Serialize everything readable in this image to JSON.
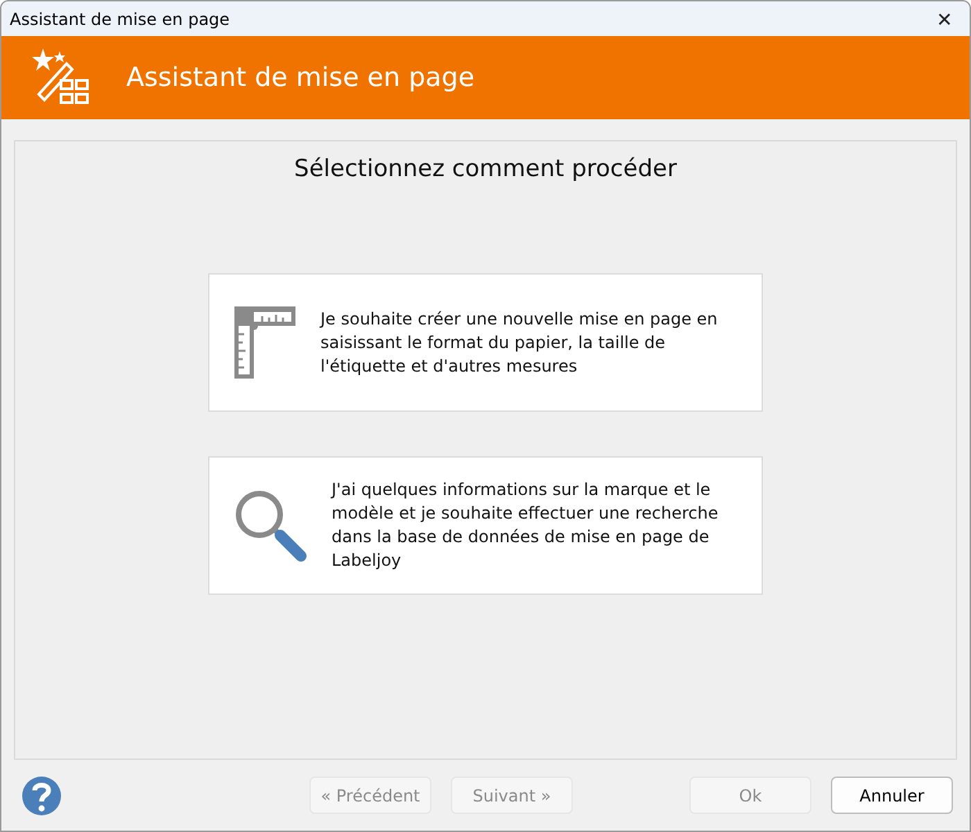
{
  "window": {
    "title": "Assistant de mise en page",
    "close": "✕"
  },
  "header": {
    "title": "Assistant de mise en page"
  },
  "heading": "Sélectionnez comment procéder",
  "options": [
    {
      "kind": "ruler",
      "text": "Je souhaite créer une nouvelle mise en page en saisissant le format du papier, la taille de l'étiquette et d'autres mesures"
    },
    {
      "kind": "search",
      "text": "J'ai quelques informations sur la marque et le modèle et je souhaite effectuer une recherche dans la base de données de mise en page de Labeljoy"
    }
  ],
  "buttons": [
    {
      "label": "« Précédent",
      "disabled": true
    },
    {
      "label": "Suivant »",
      "disabled": true
    },
    {
      "label": "Ok",
      "disabled": true
    },
    {
      "label": "Annuler",
      "disabled": false
    }
  ]
}
